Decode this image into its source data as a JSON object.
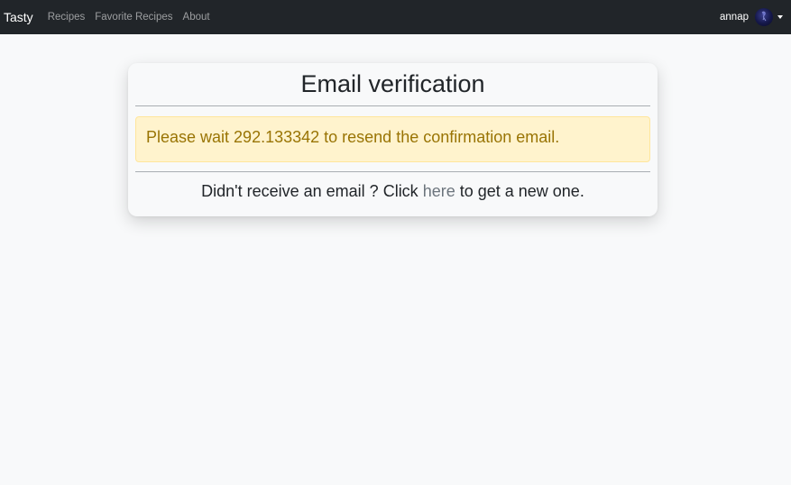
{
  "navbar": {
    "brand": "Tasty",
    "links": [
      "Recipes",
      "Favorite Recipes",
      "About"
    ],
    "username": "annap"
  },
  "card": {
    "title": "Email verification",
    "alert_text": "Please wait 292.133342 to resend the confirmation email.",
    "resend_prefix": "Didn't receive an email ? Click ",
    "resend_link": "here",
    "resend_suffix": " to get a new one."
  },
  "colors": {
    "navbar_bg": "#212529",
    "page_bg": "#f8f9fa",
    "alert_bg": "#fff3cd",
    "alert_text": "#997404",
    "link": "#6c757d"
  }
}
